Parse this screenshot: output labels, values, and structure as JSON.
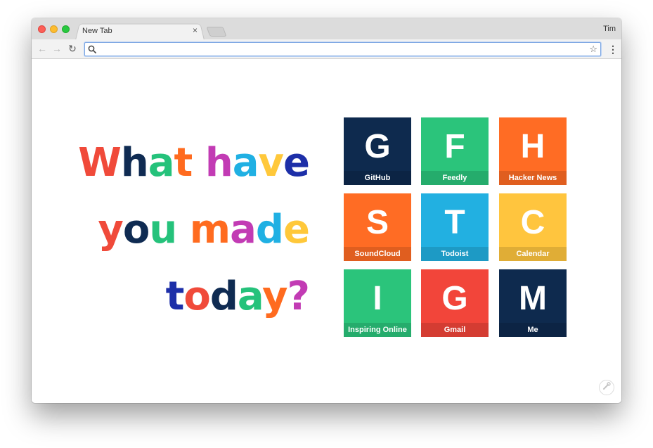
{
  "browser": {
    "tab_title": "New Tab",
    "tab_close": "×",
    "profile_name": "Tim",
    "back_icon": "←",
    "forward_icon": "→",
    "reload_icon": "↻",
    "star_icon": "☆",
    "menu_icon": "⋮",
    "omnibox_value": ""
  },
  "headline": {
    "lines": [
      "What have",
      "you made",
      "today?"
    ],
    "colors": [
      "#f04a3a",
      "#0f2b52",
      "#25c27b",
      "#ff6b1f",
      "#c23bb4",
      "#20b0e3",
      "#ffc83a",
      "#1d2fa8"
    ]
  },
  "tiles": [
    {
      "letter": "G",
      "label": "GitHub",
      "color": "#0e2a4e"
    },
    {
      "letter": "F",
      "label": "Feedly",
      "color": "#2bc47b"
    },
    {
      "letter": "H",
      "label": "Hacker News",
      "color": "#ff6c24"
    },
    {
      "letter": "S",
      "label": "SoundCloud",
      "color": "#ff6c24"
    },
    {
      "letter": "T",
      "label": "Todoist",
      "color": "#22b0e1"
    },
    {
      "letter": "C",
      "label": "Calendar",
      "color": "#ffc53e"
    },
    {
      "letter": "I",
      "label": "Inspiring Online",
      "color": "#2bc47b"
    },
    {
      "letter": "G",
      "label": "Gmail",
      "color": "#f2453a"
    },
    {
      "letter": "M",
      "label": "Me",
      "color": "#0e2a4e"
    }
  ],
  "settings_icon": "wrench-icon"
}
